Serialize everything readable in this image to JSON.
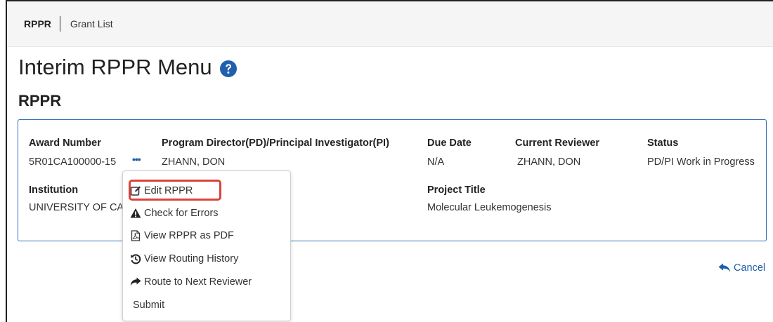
{
  "breadcrumb": {
    "current": "RPPR",
    "link": "Grant List"
  },
  "page_title": "Interim RPPR Menu",
  "section_title": "RPPR",
  "summary": {
    "award_number": {
      "label": "Award Number",
      "value": "5R01CA100000-15"
    },
    "pd_pi": {
      "label": "Program Director(PD)/Principal Investigator(PI)",
      "value": "ZHANN, DON"
    },
    "due_date": {
      "label": "Due Date",
      "value": "N/A"
    },
    "current_reviewer": {
      "label": "Current Reviewer",
      "value": "ZHANN, DON"
    },
    "status": {
      "label": "Status",
      "value": "PD/PI Work in Progress"
    },
    "institution": {
      "label": "Institution",
      "value": "UNIVERSITY OF CA"
    },
    "project_title": {
      "label": "Project Title",
      "value": "Molecular Leukemogenesis"
    }
  },
  "kebab_label": "•••",
  "actions_menu": {
    "edit": "Edit RPPR",
    "check": "Check for Errors",
    "pdf": "View RPPR as PDF",
    "history": "View Routing History",
    "route": "Route to Next Reviewer",
    "submit": "Submit"
  },
  "cancel_label": "Cancel",
  "colors": {
    "accent": "#1f5fae",
    "highlight": "#d9433a",
    "card_border": "#2f6eb5"
  },
  "icons": {
    "help": "question-circle-icon",
    "edit": "edit-pencil-square-icon",
    "check": "warning-triangle-icon",
    "pdf": "pdf-file-icon",
    "history": "history-icon",
    "route": "share-arrow-icon",
    "cancel": "reply-arrow-icon"
  }
}
